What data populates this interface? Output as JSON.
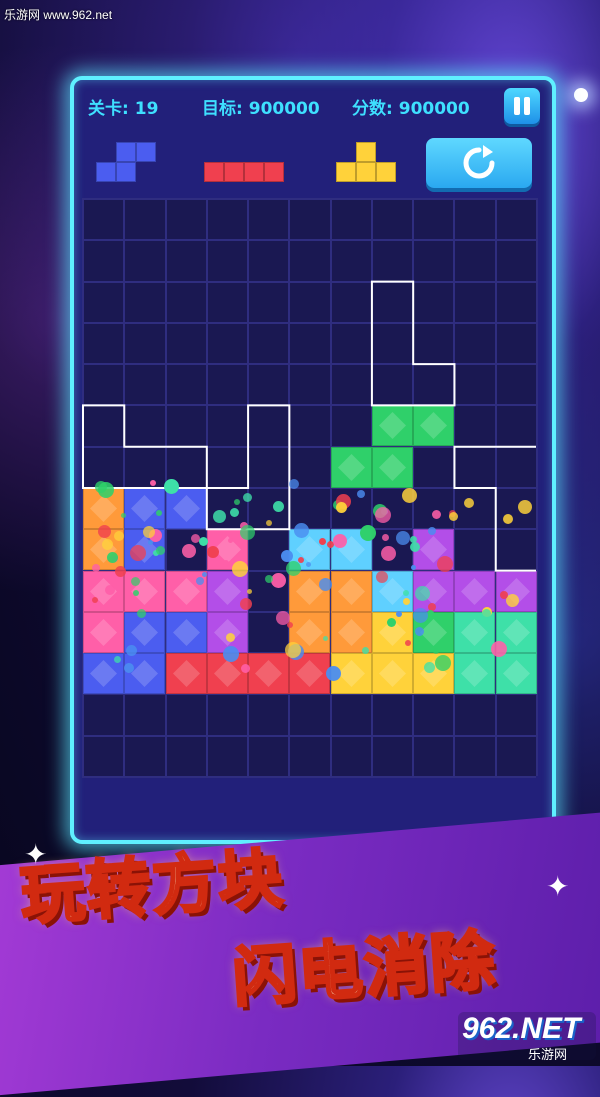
{
  "watermark": "乐游网 www.962.net",
  "hud": {
    "level_label": "关卡:",
    "level_value": "19",
    "target_label": "目标:",
    "target_value": "900000",
    "score_label": "分数:",
    "score_value": "900000"
  },
  "buttons": {
    "pause_icon": "pause-icon",
    "refresh_icon": "refresh-icon"
  },
  "colors": {
    "blue": "#4b5df0",
    "red": "#f0404f",
    "yellow": "#ffd23a",
    "orange": "#ff9a3a",
    "green": "#2fd06a",
    "mint": "#3ee0a8",
    "purple": "#b34ee8",
    "pink": "#ff5fa8",
    "cyan": "#5fd0ff",
    "frame": "#5ff0ff",
    "hud_text": "#3ee0ff"
  },
  "preview_pieces": [
    {
      "color": "blue",
      "cells": [
        [
          1,
          0
        ],
        [
          2,
          0
        ],
        [
          0,
          1
        ],
        [
          1,
          1
        ]
      ]
    },
    {
      "color": "red",
      "cells": [
        [
          0,
          0
        ],
        [
          1,
          0
        ],
        [
          2,
          0
        ],
        [
          3,
          0
        ]
      ]
    },
    {
      "color": "yellow",
      "cells": [
        [
          1,
          0
        ],
        [
          0,
          1
        ],
        [
          1,
          1
        ],
        [
          2,
          1
        ]
      ]
    }
  ],
  "board": {
    "cols": 11,
    "rows": 14,
    "blocks": [
      {
        "c": 7,
        "r": 5,
        "color": "green"
      },
      {
        "c": 8,
        "r": 5,
        "color": "green"
      },
      {
        "c": 6,
        "r": 6,
        "color": "green"
      },
      {
        "c": 7,
        "r": 6,
        "color": "green"
      },
      {
        "c": 0,
        "r": 7,
        "color": "orange"
      },
      {
        "c": 1,
        "r": 7,
        "color": "blue"
      },
      {
        "c": 2,
        "r": 7,
        "color": "blue"
      },
      {
        "c": 0,
        "r": 8,
        "color": "orange"
      },
      {
        "c": 1,
        "r": 8,
        "color": "blue"
      },
      {
        "c": 3,
        "r": 8,
        "color": "pink"
      },
      {
        "c": 5,
        "r": 8,
        "color": "cyan"
      },
      {
        "c": 6,
        "r": 8,
        "color": "cyan"
      },
      {
        "c": 8,
        "r": 8,
        "color": "purple"
      },
      {
        "c": 0,
        "r": 9,
        "color": "pink"
      },
      {
        "c": 1,
        "r": 9,
        "color": "pink"
      },
      {
        "c": 2,
        "r": 9,
        "color": "pink"
      },
      {
        "c": 3,
        "r": 9,
        "color": "purple"
      },
      {
        "c": 5,
        "r": 9,
        "color": "orange"
      },
      {
        "c": 6,
        "r": 9,
        "color": "orange"
      },
      {
        "c": 7,
        "r": 9,
        "color": "cyan"
      },
      {
        "c": 8,
        "r": 9,
        "color": "purple"
      },
      {
        "c": 9,
        "r": 9,
        "color": "purple"
      },
      {
        "c": 10,
        "r": 9,
        "color": "purple"
      },
      {
        "c": 0,
        "r": 10,
        "color": "pink"
      },
      {
        "c": 1,
        "r": 10,
        "color": "blue"
      },
      {
        "c": 2,
        "r": 10,
        "color": "blue"
      },
      {
        "c": 3,
        "r": 10,
        "color": "purple"
      },
      {
        "c": 5,
        "r": 10,
        "color": "orange"
      },
      {
        "c": 6,
        "r": 10,
        "color": "orange"
      },
      {
        "c": 7,
        "r": 10,
        "color": "yellow"
      },
      {
        "c": 8,
        "r": 10,
        "color": "green"
      },
      {
        "c": 9,
        "r": 10,
        "color": "mint"
      },
      {
        "c": 10,
        "r": 10,
        "color": "mint"
      },
      {
        "c": 0,
        "r": 11,
        "color": "blue"
      },
      {
        "c": 1,
        "r": 11,
        "color": "blue"
      },
      {
        "c": 2,
        "r": 11,
        "color": "red"
      },
      {
        "c": 3,
        "r": 11,
        "color": "red"
      },
      {
        "c": 4,
        "r": 11,
        "color": "red"
      },
      {
        "c": 5,
        "r": 11,
        "color": "red"
      },
      {
        "c": 6,
        "r": 11,
        "color": "yellow"
      },
      {
        "c": 7,
        "r": 11,
        "color": "yellow"
      },
      {
        "c": 8,
        "r": 11,
        "color": "yellow"
      },
      {
        "c": 9,
        "r": 11,
        "color": "mint"
      },
      {
        "c": 10,
        "r": 11,
        "color": "mint"
      }
    ]
  },
  "slogan": {
    "line1": "玩转方块",
    "line2": "闪电消除"
  },
  "logo": {
    "big": "962.NET",
    "small": "乐游网"
  }
}
